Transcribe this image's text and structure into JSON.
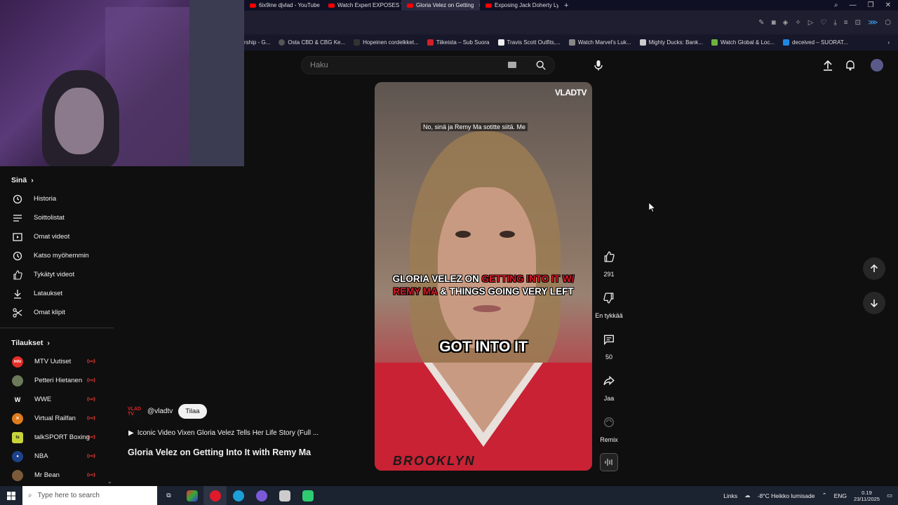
{
  "browser": {
    "tabs": [
      {
        "title": "6ix9ine djvlad - YouTube",
        "active": false
      },
      {
        "title": "Watch Expert EXPOSES \"B",
        "active": false
      },
      {
        "title": "Gloria Velez on Getting",
        "active": true
      },
      {
        "title": "Exposing Jack Doherty Ly",
        "active": false
      }
    ],
    "bookmarks": [
      "rship - G...",
      "Osta CBD & CBG Ke...",
      "Hopeinen cordelkket...",
      "Tiikeista – Sub Suora",
      "Travis Scott Outfits,...",
      "Watch Marvel's Luk...",
      "Mighty Ducks: Bank...",
      "Watch Global & Loc...",
      "deceived – SUORAT..."
    ]
  },
  "header": {
    "search_placeholder": "Haku"
  },
  "sidebar": {
    "you_title": "Sinä",
    "you_items": [
      {
        "label": "Historia",
        "icon": "history-icon"
      },
      {
        "label": "Soittolistat",
        "icon": "playlist-icon"
      },
      {
        "label": "Omat videot",
        "icon": "my-videos-icon"
      },
      {
        "label": "Katso myöhemmin",
        "icon": "watch-later-icon"
      },
      {
        "label": "Tykätyt videot",
        "icon": "like-icon"
      },
      {
        "label": "Lataukset",
        "icon": "download-icon"
      },
      {
        "label": "Omat klipit",
        "icon": "scissors-icon"
      }
    ],
    "subs_title": "Tilaukset",
    "subscriptions": [
      {
        "name": "MTV Uutiset",
        "color": "#e52d27"
      },
      {
        "name": "Petteri Hietanen",
        "color": "#6b7a5a"
      },
      {
        "name": "WWE",
        "color": "#111111"
      },
      {
        "name": "Virtual Railfan",
        "color": "#e07b1c"
      },
      {
        "name": "talkSPORT Boxing",
        "color": "#c8d43a"
      },
      {
        "name": "NBA",
        "color": "#1d428a"
      },
      {
        "name": "Mr Bean",
        "color": "#7a5a3a"
      }
    ]
  },
  "video": {
    "watermark": "VLADTV",
    "caption_small": "No, sinä ja Remy Ma sotitte siitä.  Me",
    "headline_line1_a": "GLORIA VELEZ ON ",
    "headline_line1_b": "GETTING INTO IT W/",
    "headline_line2_a": "REMY MA",
    "headline_line2_b": " & THINGS GOING VERY LEFT",
    "subtitle": "GOT INTO IT",
    "shirt_text": "BROOKLYN"
  },
  "channel": {
    "avatar_text": "VLAD TV",
    "handle": "@vladtv",
    "subscribe_label": "Tilaa",
    "related": "Iconic Video Vixen Gloria Velez Tells Her Life Story (Full ...",
    "title": "Gloria Velez on Getting Into It with Remy Ma"
  },
  "actions": {
    "likes": "291",
    "dislike_label": "En tykkää",
    "comments": "50",
    "share_label": "Jaa",
    "remix_label": "Remix"
  },
  "taskbar": {
    "search_placeholder": "Type here to search",
    "links_label": "Links",
    "weather": "-8°C  Heikko lumisade",
    "lang": "ENG",
    "time": "0.19",
    "date": "23/11/2025"
  },
  "colors": {
    "accent_red": "#ff0000",
    "background": "#0f0f0f"
  }
}
